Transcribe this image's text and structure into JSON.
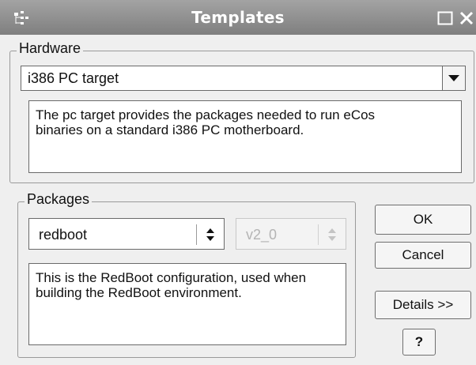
{
  "window": {
    "title": "Templates",
    "icons": {
      "app": "tree-icon",
      "maximize": "maximize-icon",
      "close": "close-icon"
    }
  },
  "hardware": {
    "group_label": "Hardware",
    "selected": "i386 PC target",
    "description": "The pc target provides the packages needed to run eCos\nbinaries on a standard i386 PC motherboard."
  },
  "packages": {
    "group_label": "Packages",
    "package_selected": "redboot",
    "version_selected": "v2_0",
    "description": "This is the RedBoot configuration, used when\nbuilding the RedBoot environment."
  },
  "buttons": {
    "ok": "OK",
    "cancel": "Cancel",
    "details": "Details >>",
    "help": "?"
  }
}
